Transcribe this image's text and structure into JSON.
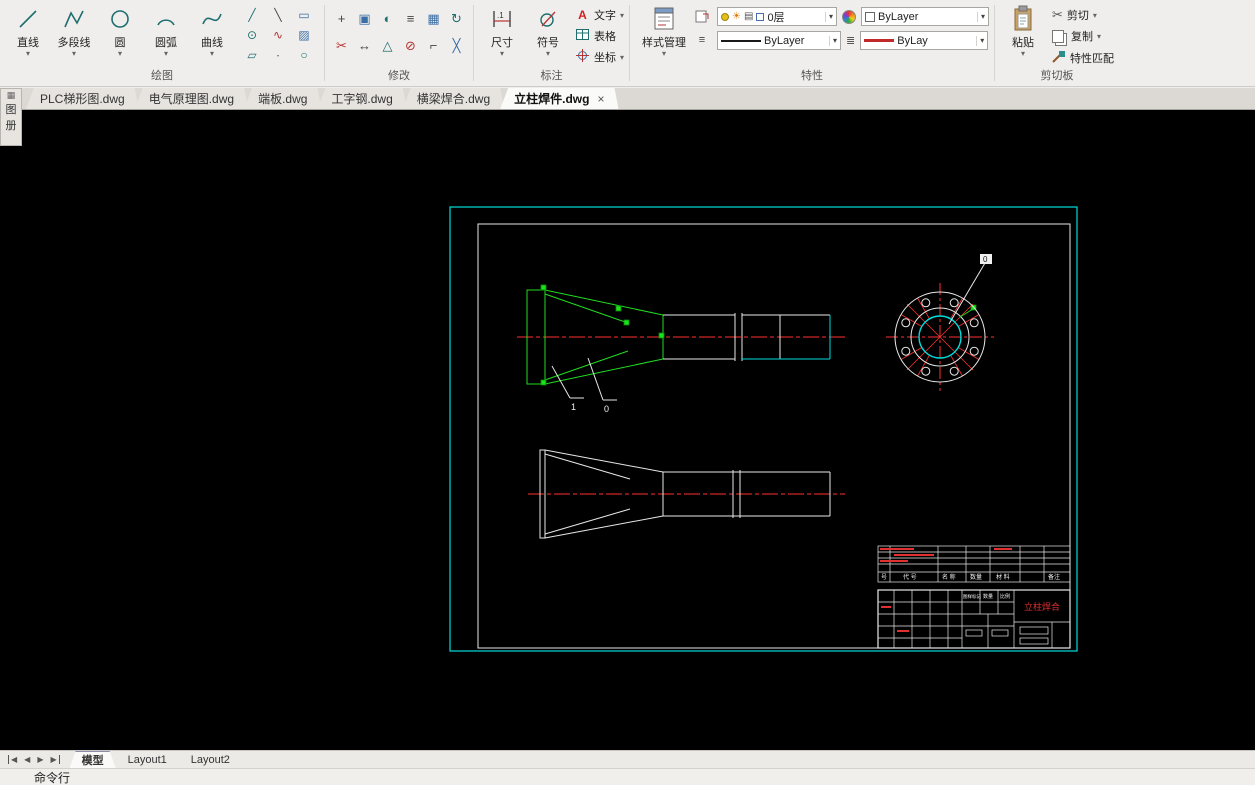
{
  "ribbon": {
    "groups": {
      "draw": {
        "label": "绘图",
        "tools": [
          {
            "label": "直线"
          },
          {
            "label": "多段线"
          },
          {
            "label": "圆"
          },
          {
            "label": "圆弧"
          },
          {
            "label": "曲线"
          }
        ]
      },
      "modify": {
        "label": "修改"
      },
      "annotate": {
        "label": "标注",
        "dimension": "尺寸",
        "symbol": "符号",
        "text": "文字",
        "table": "表格",
        "coordinate": "坐标"
      },
      "properties": {
        "label": "特性",
        "style_manager": "样式管理",
        "layer": "0层",
        "color": "ByLayer",
        "linetype": "ByLayer",
        "lineweight": "ByLay"
      },
      "clipboard": {
        "label": "剪切板",
        "paste": "粘贴",
        "cut": "剪切",
        "copy": "复制",
        "match_properties": "特性匹配"
      }
    }
  },
  "doc_tabs": {
    "items": [
      {
        "label": "PLC梯形图.dwg"
      },
      {
        "label": "电气原理图.dwg"
      },
      {
        "label": "端板.dwg"
      },
      {
        "label": "工字钢.dwg"
      },
      {
        "label": "横梁焊合.dwg"
      },
      {
        "label": "立柱焊件.dwg"
      }
    ],
    "close_glyph": "×"
  },
  "palette": {
    "char1": "图",
    "char2": "册"
  },
  "drawing": {
    "leader1": "1",
    "leader2": "0",
    "detail_label": "0",
    "title_block": {
      "title": "立柱焊合",
      "headers": [
        "号",
        "代 号",
        "名 称",
        "数量",
        "材 料",
        "备注"
      ],
      "mid_labels": [
        "图样标记",
        "数量",
        "比例"
      ]
    }
  },
  "layout_tabs": {
    "model": "模型",
    "layout1": "Layout1",
    "layout2": "Layout2"
  },
  "statusbar": {
    "command_label": "命令行"
  }
}
